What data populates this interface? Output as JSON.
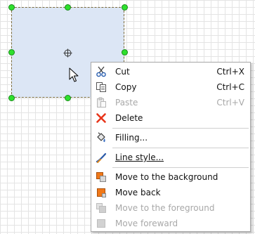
{
  "context_menu": {
    "items": [
      {
        "label": "Cut",
        "shortcut": "Ctrl+X",
        "icon": "scissors-icon",
        "enabled": true
      },
      {
        "label": "Copy",
        "shortcut": "Ctrl+C",
        "icon": "copy-icon",
        "enabled": true
      },
      {
        "label": "Paste",
        "shortcut": "Ctrl+V",
        "icon": "paste-icon",
        "enabled": false
      },
      {
        "label": "Delete",
        "shortcut": "",
        "icon": "delete-x-icon",
        "enabled": true
      },
      {
        "label": "Filling...",
        "shortcut": "",
        "icon": "paint-bucket-icon",
        "enabled": true
      },
      {
        "label": "Line style...",
        "shortcut": "",
        "icon": "line-style-icon",
        "enabled": true
      },
      {
        "label": "Move to the background",
        "shortcut": "",
        "icon": "send-to-back-icon",
        "enabled": true
      },
      {
        "label": "Move back",
        "shortcut": "",
        "icon": "send-backward-icon",
        "enabled": true
      },
      {
        "label": "Move to the foreground",
        "shortcut": "",
        "icon": "bring-to-front-icon",
        "enabled": false
      },
      {
        "label": "Move foreward",
        "shortcut": "",
        "icon": "bring-forward-icon",
        "enabled": false
      }
    ]
  },
  "colors": {
    "shape_fill": "#dce6f5",
    "handle": "#2ee02e",
    "delete_red": "#e8361b",
    "layer_orange": "#f07818",
    "disabled": "#a8a8a8"
  }
}
